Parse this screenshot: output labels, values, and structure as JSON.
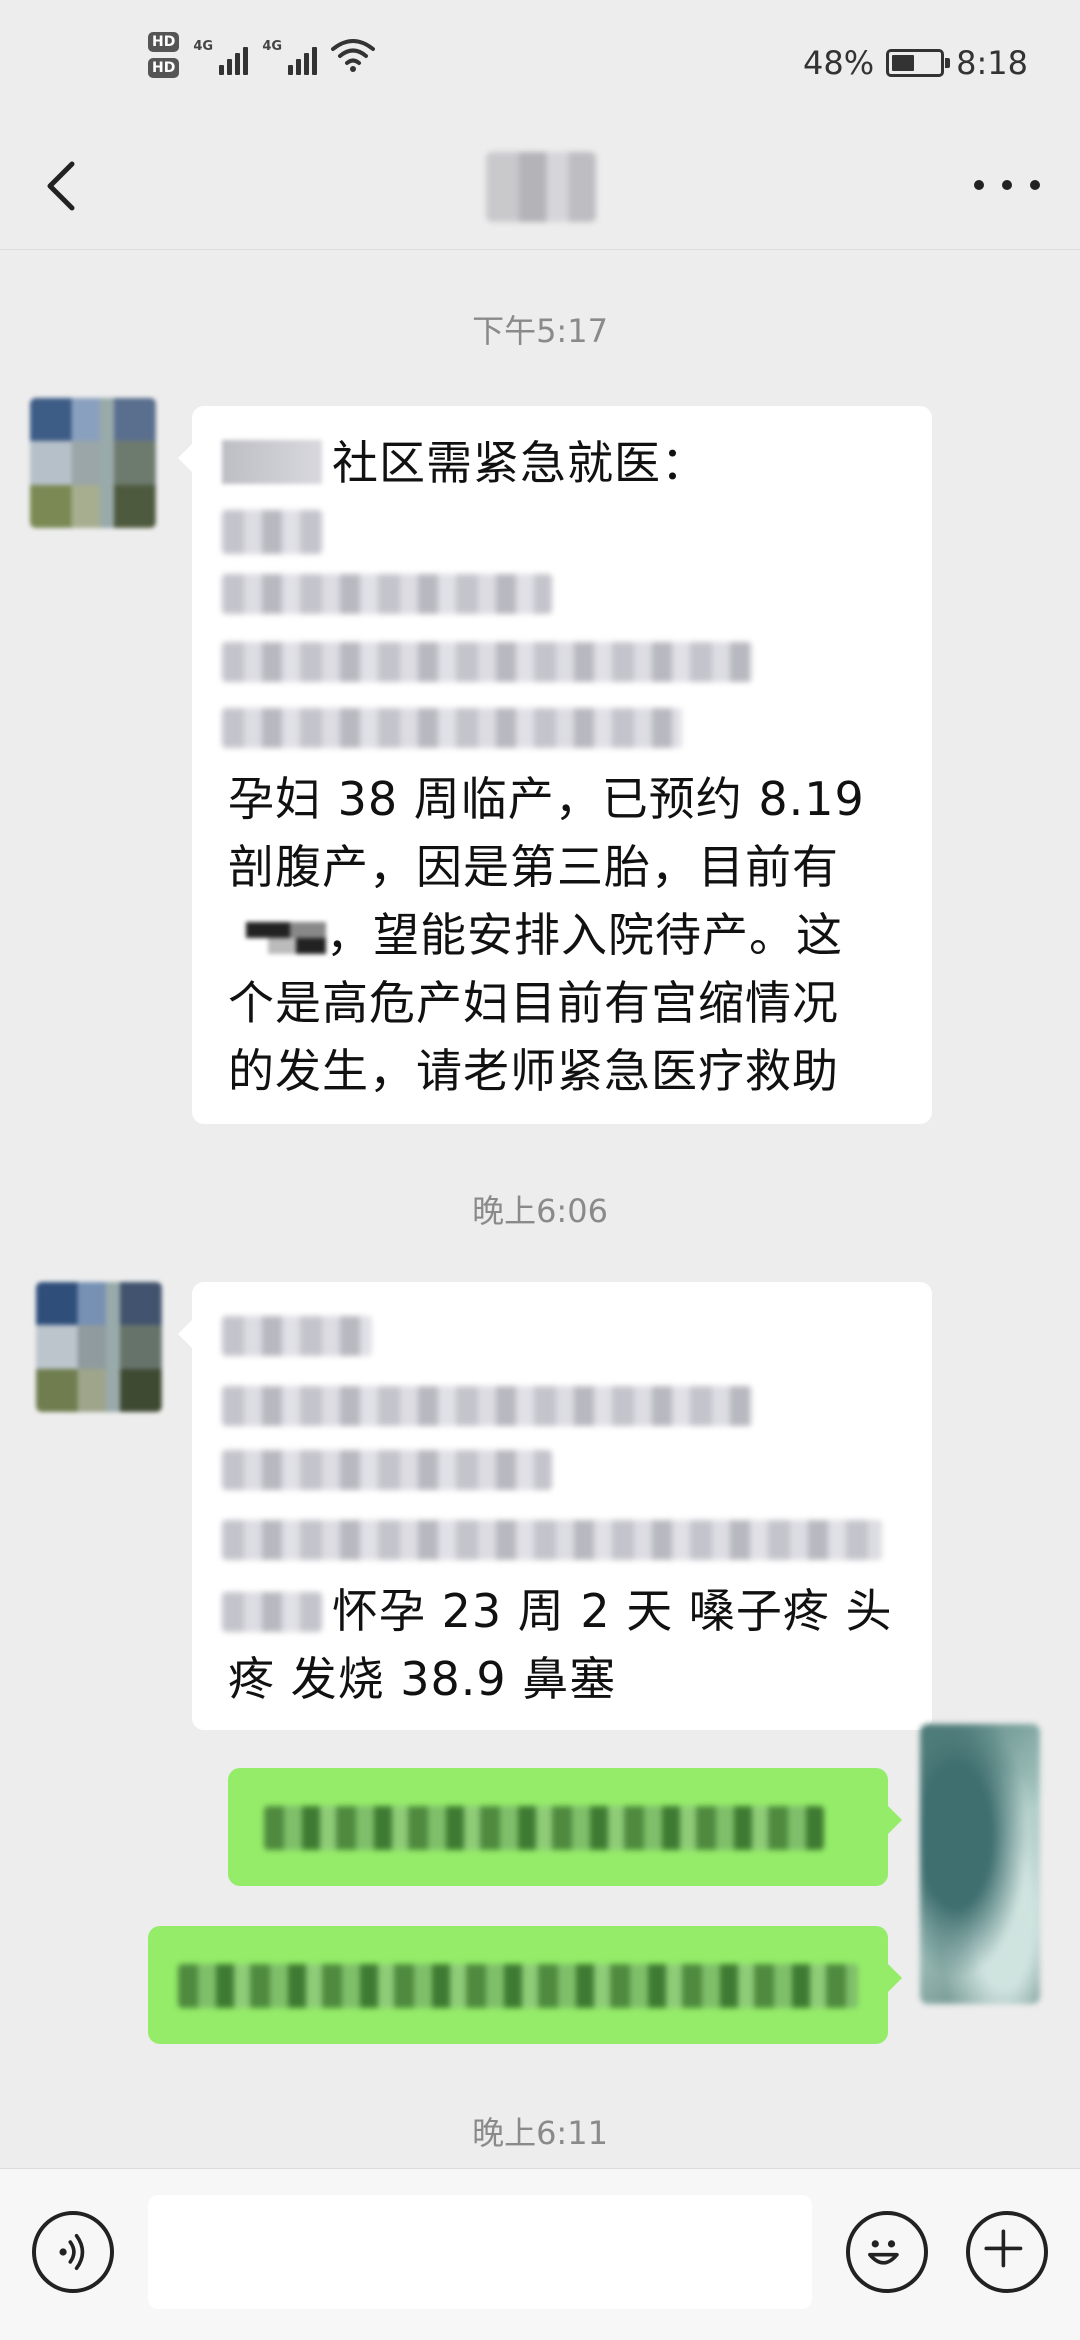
{
  "status_bar": {
    "hd1": "HD",
    "hd2": "HD",
    "net1": "4G",
    "net2": "4G",
    "battery_text": "48%",
    "battery_level": 0.48,
    "time": "8:18"
  },
  "nav": {
    "back_icon": "chevron-left-icon",
    "more_icon": "more-dots-icon"
  },
  "messages": [
    {
      "timestamp": "下午5:17",
      "sender": "contact",
      "header": "社区需紧急就医：",
      "lines": [
        "孕妇 38 周临产，已预约 8.19",
        "剖腹产，因是第三胎，目前有",
        "，望能安排入院待产。这",
        "个是高危产妇目前有宫缩情况",
        "的发生，请老师紧急医疗救助"
      ]
    },
    {
      "timestamp": "晚上6:06",
      "sender": "contact",
      "lines": [
        "怀孕 23 周 2 天 嗓子疼 头",
        "疼 发烧 38.9 鼻塞"
      ]
    },
    {
      "sender": "self"
    },
    {
      "sender": "self"
    }
  ],
  "last_timestamp": "晚上6:11",
  "input_bar": {
    "voice_icon": "voice-icon",
    "emoji_icon": "emoji-icon",
    "plus_icon": "plus-icon",
    "placeholder": ""
  },
  "colors": {
    "background": "#ededed",
    "incoming_bubble": "#ffffff",
    "outgoing_bubble": "#95ec69",
    "timestamp": "#8a8a8a"
  }
}
